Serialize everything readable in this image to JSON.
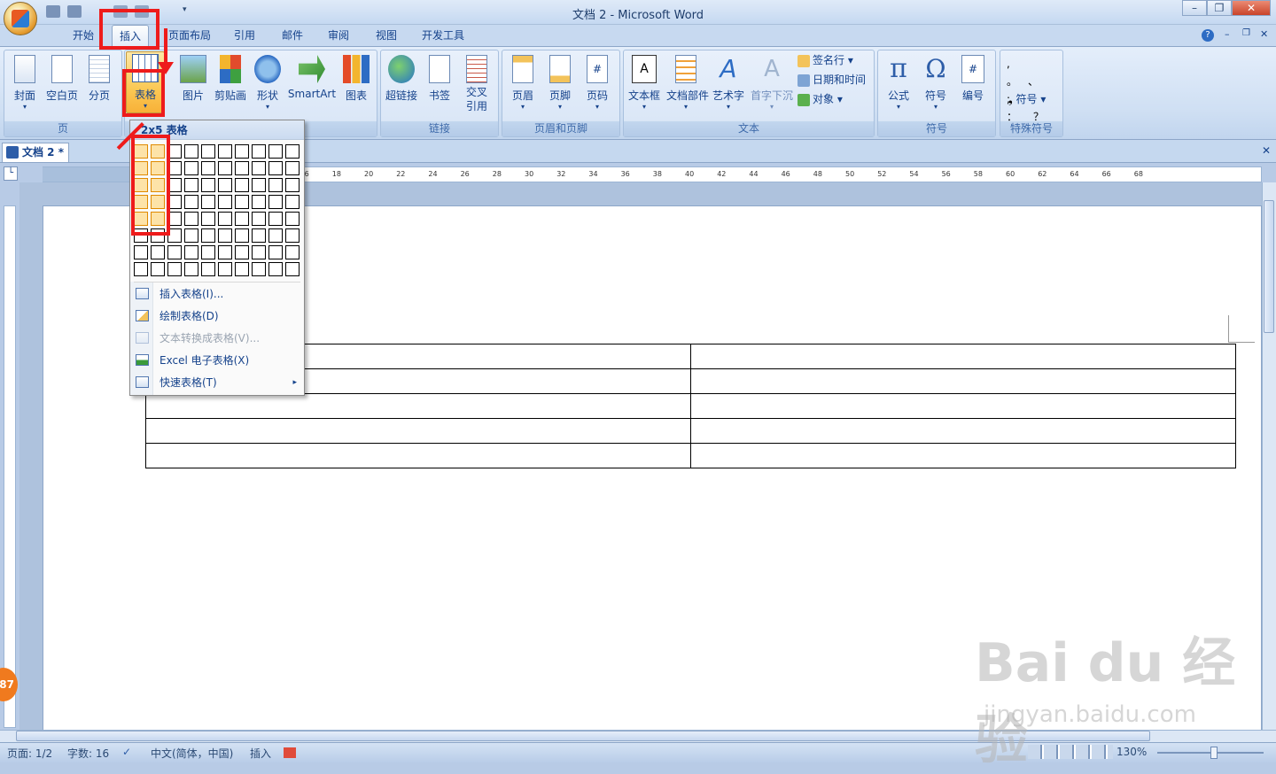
{
  "window": {
    "title": "文档 2 - Microsoft Word"
  },
  "tabs": [
    "开始",
    "插入",
    "页面布局",
    "引用",
    "邮件",
    "审阅",
    "视图",
    "开发工具"
  ],
  "ribbon": {
    "groups": {
      "page": {
        "label": "页",
        "buttons": [
          "封面",
          "空白页",
          "分页"
        ]
      },
      "table": {
        "button": "表格"
      },
      "illustrations": {
        "buttons": [
          "图片",
          "剪贴画",
          "形状",
          "SmartArt",
          "图表"
        ]
      },
      "links": {
        "label": "链接",
        "buttons": [
          "超链接",
          "书签",
          "交叉\n引用"
        ]
      },
      "header_footer": {
        "label": "页眉和页脚",
        "buttons": [
          "页眉",
          "页脚",
          "页码"
        ]
      },
      "text": {
        "label": "文本",
        "buttons": [
          "文本框",
          "文档部件",
          "艺术字",
          "首字下沉"
        ],
        "small": [
          "签名行",
          "日期和时间",
          "对象"
        ]
      },
      "symbols": {
        "label": "符号",
        "buttons": [
          "公式",
          "符号",
          "编号"
        ]
      },
      "special": {
        "label": "特殊符号",
        "small": [
          "符号"
        ]
      }
    }
  },
  "document_tab": "文档 2 *",
  "dropdown": {
    "header": "2x5 表格",
    "items": [
      "插入表格(I)...",
      "绘制表格(D)",
      "文本转换成表格(V)...",
      "Excel 电子表格(X)",
      "快速表格(T)"
    ]
  },
  "status": {
    "page": "页面: 1/2",
    "words": "字数: 16",
    "language": "中文(简体，中国)",
    "mode": "插入",
    "zoom": "130%"
  },
  "watermark": {
    "main": "Bai du 经验",
    "sub": "jingyan.baidu.com",
    "badge": "87"
  }
}
